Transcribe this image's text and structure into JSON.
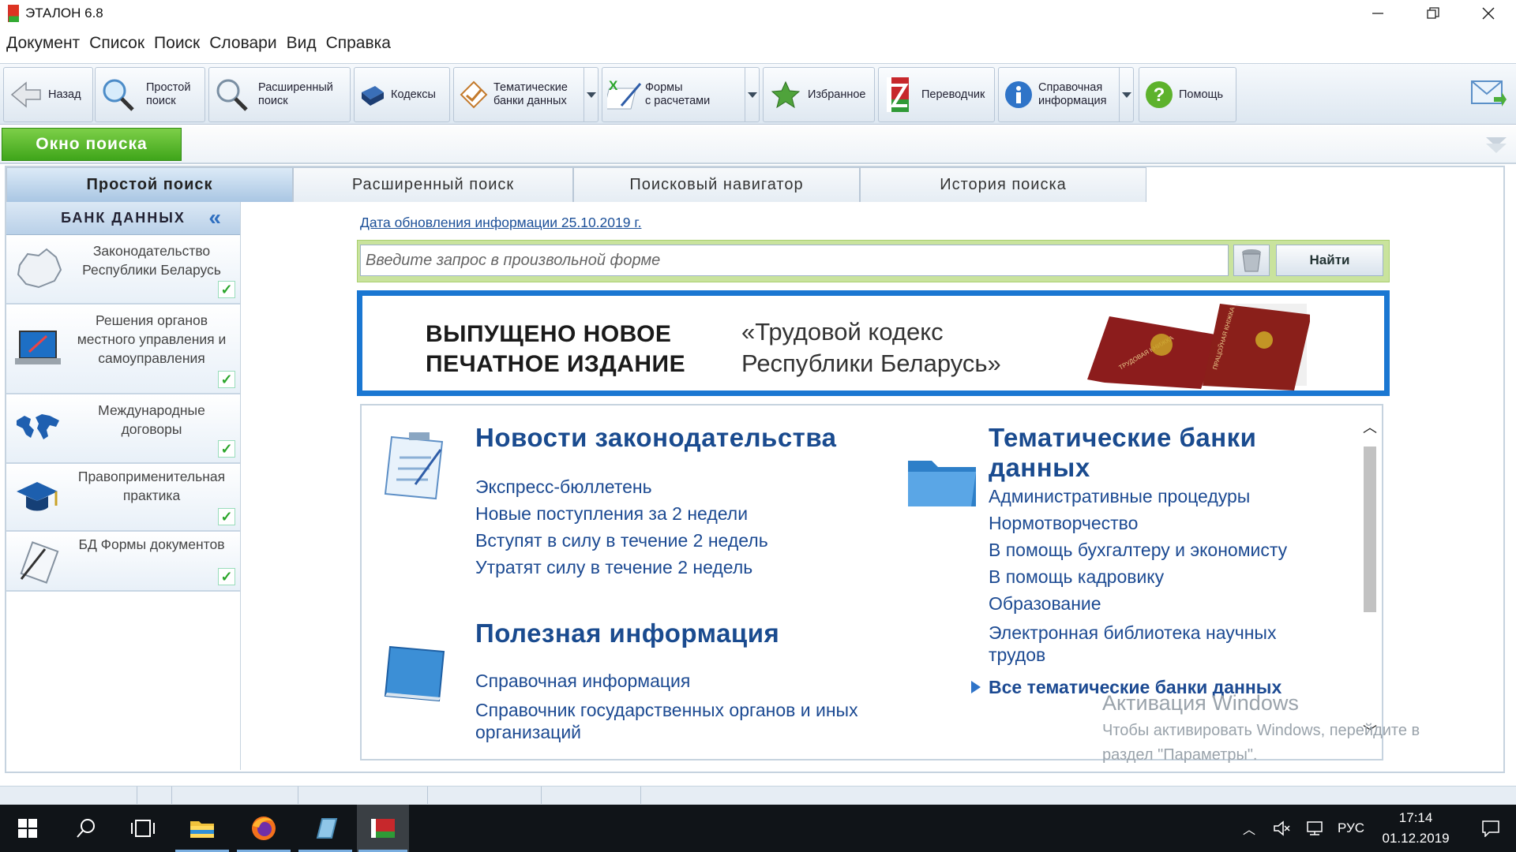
{
  "window": {
    "title": "ЭТАЛОН 6.8",
    "minimize_icon": "minimize-icon",
    "restore_icon": "restore-icon",
    "close_icon": "close-icon"
  },
  "menu": [
    "Документ",
    "Список",
    "Поиск",
    "Словари",
    "Вид",
    "Справка"
  ],
  "toolbar": {
    "back": "Назад",
    "simple_search_1": "Простой",
    "simple_search_2": "поиск",
    "ext_search_1": "Расширенный",
    "ext_search_2": "поиск",
    "codes": "Кодексы",
    "thematic_1": "Тематические",
    "thematic_2": "банки данных",
    "forms_1": "Формы",
    "forms_2": "с расчетами",
    "favorites": "Избранное",
    "translator": "Переводчик",
    "reference_1": "Справочная",
    "reference_2": "информация",
    "help": "Помощь"
  },
  "search_window_label": "Окно поиска",
  "tabs": [
    "Простой поиск",
    "Расширенный поиск",
    "Поисковый навигатор",
    "История поиска"
  ],
  "sidebar": {
    "header": "БАНК ДАННЫХ",
    "items": [
      {
        "label": "Законодательство Республики Беларусь",
        "icon": "belarus-map-icon",
        "checked": true
      },
      {
        "label": "Решения органов местного управления и самоуправления",
        "icon": "laptop-icon",
        "checked": true
      },
      {
        "label": "Международные договоры",
        "icon": "world-map-icon",
        "checked": true
      },
      {
        "label": "Правоприменительная практика",
        "icon": "graduation-cap-icon",
        "checked": true
      },
      {
        "label": "БД Формы документов",
        "icon": "document-pen-icon",
        "checked": true
      }
    ]
  },
  "update_link": "Дата обновления информации 25.10.2019 г.",
  "search": {
    "placeholder": "Введите запрос в произвольной форме",
    "button": "Найти"
  },
  "banner": {
    "line1": "ВЫПУЩЕНО НОВОЕ",
    "line2": "ПЕЧАТНОЕ ИЗДАНИЕ",
    "title1": "«Трудовой кодекс",
    "title2": "Республики Беларусь»",
    "book1": "ТРУДОВАЯ КНИЖКА",
    "book2": "ПРАЦОЎНАЯ КНІЖКА"
  },
  "news": {
    "title": "Новости законодательства",
    "links": [
      "Экспресс-бюллетень",
      "Новые поступления за 2 недели",
      "Вступят в силу в течение 2 недель",
      "Утратят силу в течение 2 недель"
    ]
  },
  "useful": {
    "title": "Полезная информация",
    "links": [
      "Справочная информация",
      "Справочник государственных органов и иных организаций"
    ]
  },
  "thematic": {
    "title1": "Тематические банки",
    "title2": "данных",
    "links": [
      "Административные процедуры",
      "Нормотворчество",
      "В помощь бухгалтеру и экономисту",
      "В помощь кадровику",
      "Образование",
      "Электронная библиотека научных трудов"
    ],
    "all": "Все тематические банки данных"
  },
  "watermark": {
    "line1": "Активация Windows",
    "line2": "Чтобы активировать Windows, перейдите в",
    "line3": "раздел \"Параметры\"."
  },
  "taskbar": {
    "lang": "РУС",
    "time": "17:14",
    "date": "01.12.2019"
  }
}
